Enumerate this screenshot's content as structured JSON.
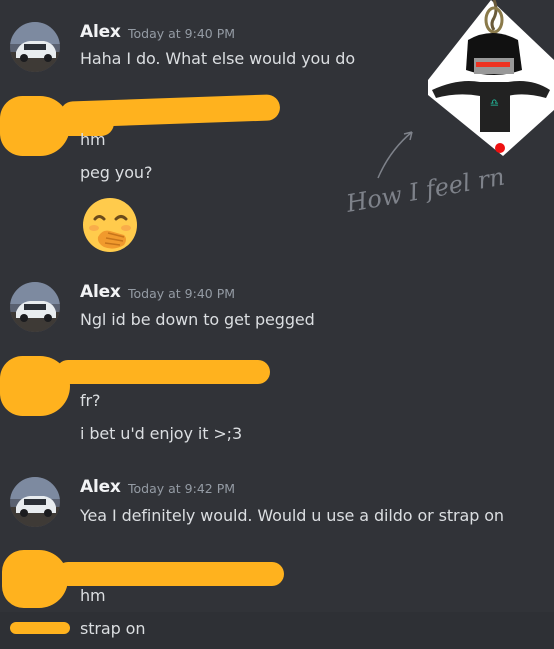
{
  "messages": [
    {
      "author": "Alex",
      "timestamp": "Today at 9:40 PM",
      "lines": [
        "Haha I do. What else would you do"
      ]
    },
    {
      "author": "",
      "timestamp": "",
      "lines": [
        "hm",
        "peg you?"
      ],
      "emoji": "hand-over-mouth-emoji"
    },
    {
      "author": "Alex",
      "timestamp": "Today at 9:40 PM",
      "lines": [
        "Ngl id be down to get pegged"
      ]
    },
    {
      "author": "",
      "timestamp": "",
      "lines": [
        "fr?",
        "i  bet u'd enjoy it >;3"
      ]
    },
    {
      "author": "Alex",
      "timestamp": "Today at 9:42 PM",
      "lines": [
        "Yea I definitely would. Would u use a dildo or strap on"
      ]
    },
    {
      "author": "",
      "timestamp": "",
      "lines": [
        "hm",
        "strap on"
      ]
    }
  ],
  "annotation": {
    "handwritten": "How I feel rn"
  },
  "colors": {
    "background": "#313338",
    "hover_row": "#2e3035",
    "redaction": "#ffb21e",
    "author": "#f2f3f5",
    "timestamp": "#949ba4",
    "message_text": "#dbdee1"
  }
}
